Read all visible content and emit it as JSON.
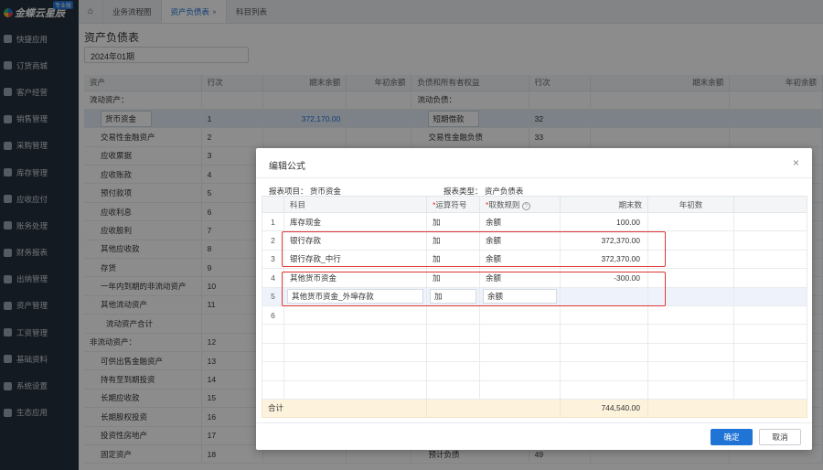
{
  "app": {
    "logo_text": "金蝶云星辰",
    "edition_badge": "专业版"
  },
  "sidebar": {
    "items": [
      {
        "label": "快捷应用",
        "icon": "grid-icon"
      },
      {
        "label": "订货商城",
        "icon": "store-icon"
      },
      {
        "label": "客户经营",
        "icon": "customer-icon"
      },
      {
        "label": "销售管理",
        "icon": "chart-icon"
      },
      {
        "label": "采购管理",
        "icon": "cart-icon"
      },
      {
        "label": "库存管理",
        "icon": "box-icon"
      },
      {
        "label": "应收应付",
        "icon": "receivable-icon"
      },
      {
        "label": "账务处理",
        "icon": "ledger-icon"
      },
      {
        "label": "财务报表",
        "icon": "report-icon"
      },
      {
        "label": "出纳管理",
        "icon": "cashier-icon"
      },
      {
        "label": "资产管理",
        "icon": "asset-icon"
      },
      {
        "label": "工资管理",
        "icon": "salary-icon"
      },
      {
        "label": "基础资料",
        "icon": "database-icon"
      },
      {
        "label": "系统设置",
        "icon": "gear-icon"
      },
      {
        "label": "生态应用",
        "icon": "ecosystem-icon"
      }
    ]
  },
  "tabs": [
    {
      "label": "业务流程图",
      "active": false
    },
    {
      "label": "资产负债表",
      "active": true,
      "close": "×"
    },
    {
      "label": "科目列表",
      "active": false
    }
  ],
  "page": {
    "title": "资产负债表",
    "period": "2024年01期"
  },
  "balance_sheet": {
    "headers": {
      "asset": "资产",
      "line_no": "行次",
      "end_balance": "期末余额",
      "begin_balance": "年初余额",
      "liability": "负债和所有者权益",
      "line_no2": "行次",
      "end_balance2": "期末余额",
      "begin_balance2": "年初余额"
    },
    "rows": [
      {
        "a": "流动资产：",
        "an": "",
        "ae": "",
        "ab": "",
        "l": "流动负债：",
        "ln": "",
        "style": "h"
      },
      {
        "a": "货币资金",
        "an": "1",
        "ae": "372,170.00",
        "ab": "",
        "l": "短期借款",
        "ln": "32",
        "style": "sel"
      },
      {
        "a": "交易性金融资产",
        "an": "2",
        "ae": "",
        "ab": "",
        "l": "交易性金融负债",
        "ln": "33",
        "style": ""
      },
      {
        "a": "应收票据",
        "an": "3",
        "ae": "",
        "ab": "",
        "l": "",
        "ln": "",
        "style": ""
      },
      {
        "a": "应收账款",
        "an": "4",
        "ae": "",
        "ab": "",
        "l": "",
        "ln": "",
        "style": ""
      },
      {
        "a": "预付款项",
        "an": "5",
        "ae": "",
        "ab": "",
        "l": "",
        "ln": "",
        "style": ""
      },
      {
        "a": "应收利息",
        "an": "6",
        "ae": "",
        "ab": "",
        "l": "",
        "ln": "",
        "style": ""
      },
      {
        "a": "应收股利",
        "an": "7",
        "ae": "",
        "ab": "",
        "l": "",
        "ln": "",
        "style": ""
      },
      {
        "a": "其他应收款",
        "an": "8",
        "ae": "",
        "ab": "",
        "l": "",
        "ln": "",
        "style": ""
      },
      {
        "a": "存货",
        "an": "9",
        "ae": "",
        "ab": "",
        "l": "",
        "ln": "",
        "style": ""
      },
      {
        "a": "一年内到期的非流动资产",
        "an": "10",
        "ae": "",
        "ab": "",
        "l": "",
        "ln": "",
        "style": ""
      },
      {
        "a": "其他流动资产",
        "an": "11",
        "ae": "",
        "ab": "",
        "l": "",
        "ln": "",
        "style": ""
      },
      {
        "a": "流动资产合计",
        "an": "",
        "ae": "",
        "ab": "",
        "l": "",
        "ln": "",
        "style": "sub"
      },
      {
        "a": "非流动资产：",
        "an": "12",
        "ae": "",
        "ab": "",
        "l": "",
        "ln": "",
        "style": "h"
      },
      {
        "a": "可供出售金融资产",
        "an": "13",
        "ae": "",
        "ab": "",
        "l": "",
        "ln": "",
        "style": ""
      },
      {
        "a": "持有至到期投资",
        "an": "14",
        "ae": "",
        "ab": "",
        "l": "",
        "ln": "",
        "style": ""
      },
      {
        "a": "长期应收款",
        "an": "15",
        "ae": "",
        "ab": "",
        "l": "",
        "ln": "",
        "style": ""
      },
      {
        "a": "长期股权投资",
        "an": "16",
        "ae": "",
        "ab": "",
        "l": "",
        "ln": "",
        "style": ""
      },
      {
        "a": "投资性房地产",
        "an": "17",
        "ae": "",
        "ab": "",
        "l": "",
        "ln": "",
        "style": ""
      },
      {
        "a": "固定资产",
        "an": "18",
        "ae": "",
        "ab": "",
        "l": "预计负债",
        "ln": "49",
        "style": ""
      }
    ]
  },
  "dialog": {
    "title": "编辑公式",
    "close": "×",
    "report_item_label": "报表项目：",
    "report_item_value": "货币资金",
    "report_type_label": "报表类型：",
    "report_type_value": "资产负债表",
    "headers": {
      "subject": "科目",
      "operator": "运算符号",
      "rule": "取数规则",
      "end": "期末数",
      "begin": "年初数",
      "required_mark": "*",
      "help": "?"
    },
    "rows": [
      {
        "no": "1",
        "subject": "库存现金",
        "op": "加",
        "rule": "余额",
        "end": "100.00",
        "begin": ""
      },
      {
        "no": "2",
        "subject": "银行存款",
        "op": "加",
        "rule": "余额",
        "end": "372,370.00",
        "begin": ""
      },
      {
        "no": "3",
        "subject": "银行存款_中行",
        "op": "加",
        "rule": "余额",
        "end": "372,370.00",
        "begin": ""
      },
      {
        "no": "4",
        "subject": "其他货币资金",
        "op": "加",
        "rule": "余额",
        "end": "-300.00",
        "begin": ""
      },
      {
        "no": "5",
        "subject": "其他货币资金_外埠存款",
        "op": "加",
        "rule": "余额",
        "end": "",
        "begin": ""
      },
      {
        "no": "6",
        "subject": "",
        "op": "",
        "rule": "",
        "end": "",
        "begin": ""
      }
    ],
    "total_label": "合计",
    "total_end": "744,540.00",
    "ok_label": "确定",
    "cancel_label": "取消"
  },
  "colors": {
    "accent": "#1f74d6",
    "highlight_box": "#e03535",
    "sidebar_bg": "#26303c",
    "total_row_bg": "#fdf3dd"
  }
}
